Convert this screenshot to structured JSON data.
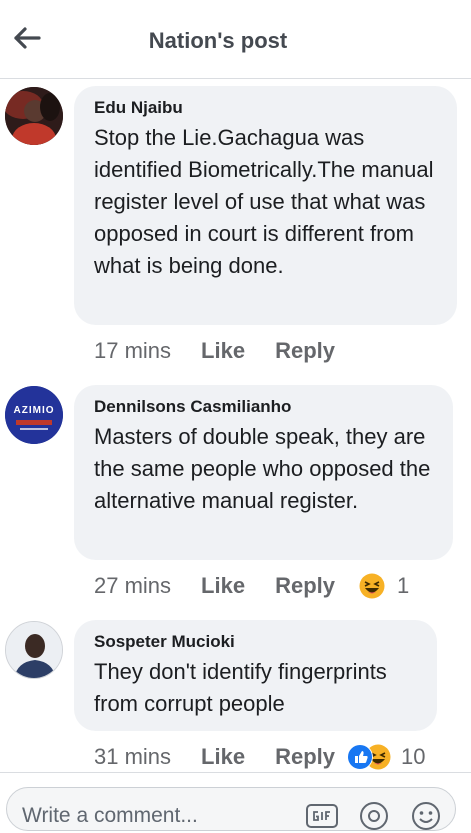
{
  "header": {
    "title": "Nation's post"
  },
  "comments": [
    {
      "author": "Edu Njaibu",
      "text": "Stop the Lie.Gachagua was identified Biometrically.The manual register level of use that what was opposed in court is different from  what is being done.",
      "time": "17 mins",
      "like_label": "Like",
      "reply_label": "Reply"
    },
    {
      "author": "Dennilsons Casmilianho",
      "avatar_text": "AZIMIO",
      "text": "Masters of double speak, they are the same people who opposed the alternative manual register.",
      "time": "27 mins",
      "like_label": "Like",
      "reply_label": "Reply",
      "reaction_count": "1"
    },
    {
      "author": "Sospeter Mucioki",
      "text": "They don't identify fingerprints from corrupt people",
      "time": "31 mins",
      "like_label": "Like",
      "reply_label": "Reply",
      "reaction_count": "10"
    }
  ],
  "composer": {
    "placeholder": "Write a comment..."
  },
  "colors": {
    "like_blue": "#1877f2",
    "haha_yellow": "#f7b125",
    "bubble": "#f0f2f5"
  }
}
